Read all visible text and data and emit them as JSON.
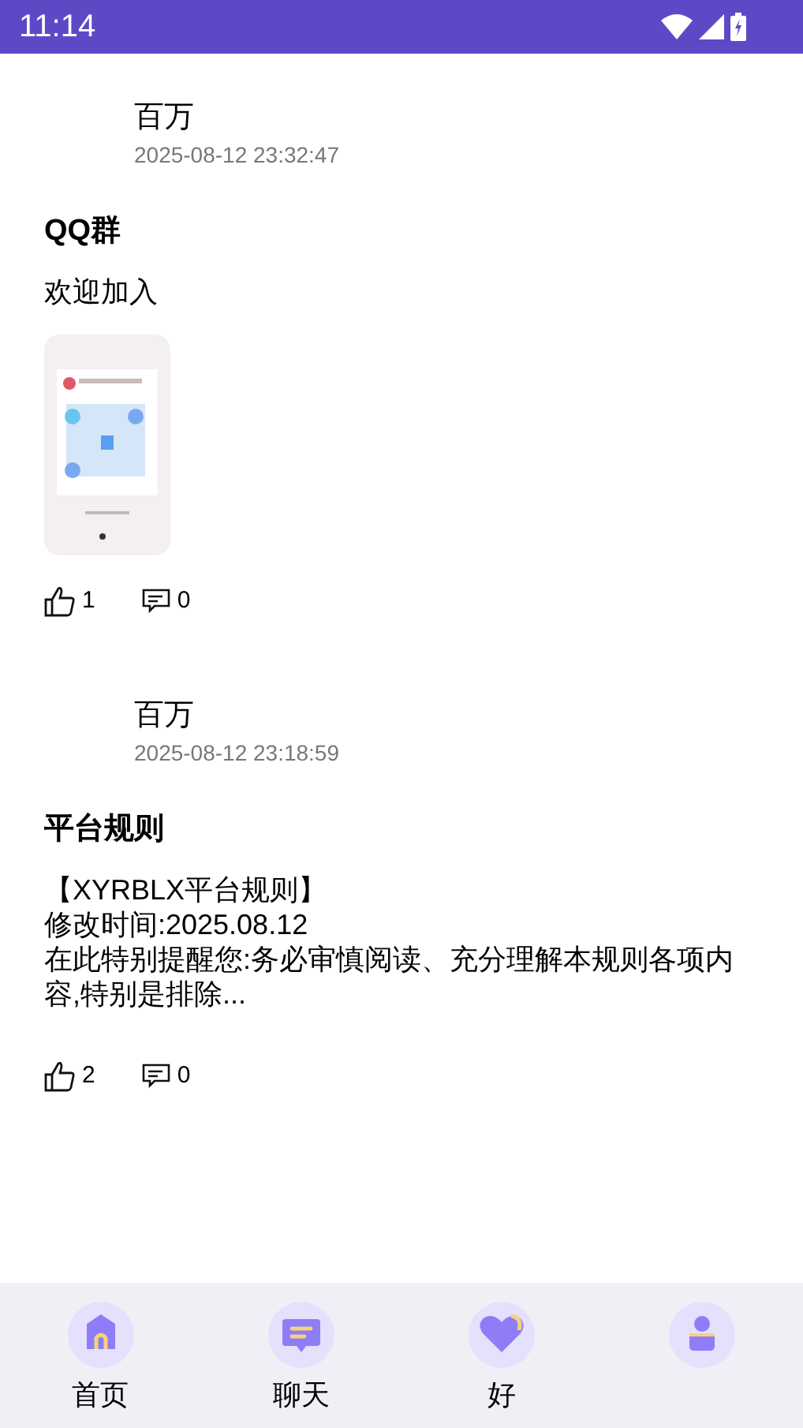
{
  "status_bar": {
    "time": "11:14"
  },
  "posts": [
    {
      "author": "百万",
      "time": "2025-08-12 23:32:47",
      "title": "QQ群",
      "body": [
        "欢迎加入"
      ],
      "image": {
        "kind": "picture"
      },
      "likes": "1",
      "comments": "0"
    },
    {
      "author": "百万",
      "time": "2025-08-12 23:18:59",
      "title": "平台规则",
      "body": [
        "【XYRBLX平台规则】",
        "修改时间:2025.08.12",
        "在此特别提醒您:务必审慎阅读、充分理解本规则各项内容,特别是排除..."
      ],
      "likes": "2",
      "comments": "0"
    }
  ],
  "nav": [
    {
      "kind": "home",
      "label": "首页"
    },
    {
      "kind": "chat",
      "label": "聊天"
    },
    {
      "kind": "friends",
      "label": "好"
    },
    {
      "kind": "profile"
    }
  ]
}
